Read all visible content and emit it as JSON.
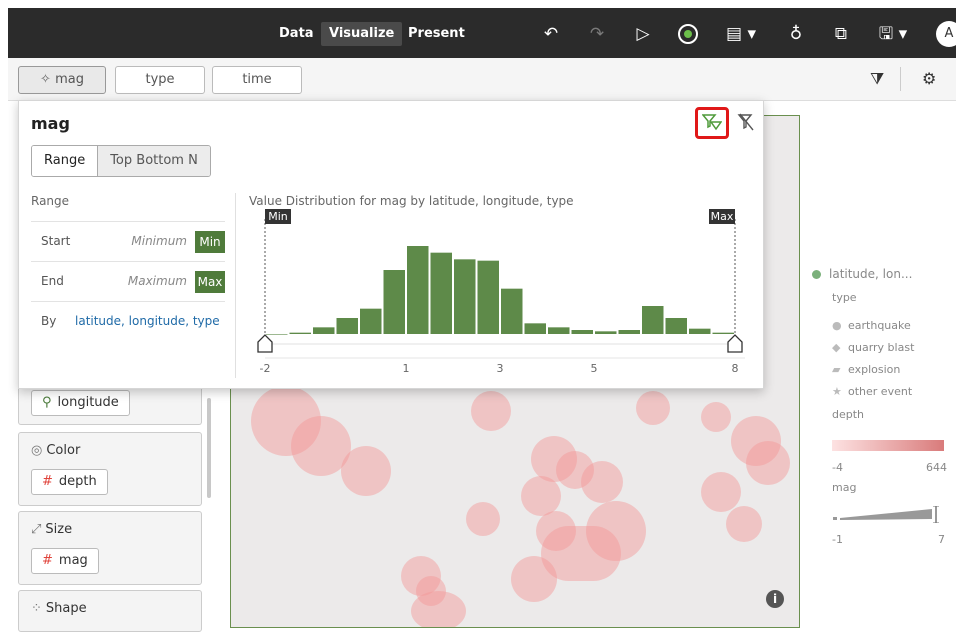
{
  "topbar": {
    "tabs": [
      "Data",
      "Visualize",
      "Present"
    ],
    "active_tab": "Visualize",
    "icons": [
      "undo-icon",
      "redo-icon",
      "play-icon",
      "record-icon",
      "comment-icon",
      "lightbulb-icon",
      "export-icon",
      "save-icon"
    ],
    "avatar": "A"
  },
  "filter_bar": {
    "filters": [
      "mag",
      "type",
      "time"
    ]
  },
  "grammar": {
    "longitude_chip": "longitude",
    "color": {
      "label": "Color",
      "chip": "depth"
    },
    "size": {
      "label": "Size",
      "chip": "mag"
    },
    "shape": {
      "label": "Shape"
    }
  },
  "popup": {
    "title": "mag",
    "tabs": [
      "Range",
      "Top Bottom N"
    ],
    "section_label": "Range",
    "rows": [
      {
        "label": "Start",
        "value": "Minimum",
        "badge": "Min"
      },
      {
        "label": "End",
        "value": "Maximum",
        "badge": "Max"
      }
    ],
    "by_label": "By",
    "by_value": "latitude, longitude, type",
    "chart_title": "Value Distribution for mag by latitude, longitude, type",
    "min_marker": "Min",
    "max_marker": "Max"
  },
  "chart_data": {
    "type": "bar",
    "title": "Value Distribution for mag by latitude, longitude, type",
    "xlabel": "",
    "ylabel": "",
    "x_ticks": [
      "-2",
      "1",
      "3",
      "5",
      "8"
    ],
    "bin_centers": [
      -1.75,
      -1.25,
      -0.75,
      -0.25,
      0.25,
      0.75,
      1.25,
      1.75,
      2.25,
      2.75,
      3.25,
      3.75,
      4.25,
      4.75,
      5.25,
      5.75,
      6.25,
      6.75,
      7.25,
      7.75
    ],
    "values": [
      0,
      1,
      5,
      12,
      19,
      48,
      66,
      61,
      56,
      55,
      34,
      8,
      5,
      3,
      2,
      3,
      21,
      12,
      4,
      1
    ],
    "range_min_label": "Min",
    "range_max_label": "Max",
    "grid": false
  },
  "legend": {
    "title": "latitude, lon...",
    "type_label": "type",
    "types": [
      {
        "name": "earthquake",
        "mark": "●"
      },
      {
        "name": "quarry blast",
        "mark": "◆"
      },
      {
        "name": "explosion",
        "mark": "▰"
      },
      {
        "name": "other event",
        "mark": "★"
      }
    ],
    "depth_label": "depth",
    "depth_min": "-4",
    "depth_max": "644",
    "mag_label": "mag",
    "mag_min": "-1",
    "mag_max": "7",
    "colors": {
      "accent": "#4f7b3b",
      "bar": "#5e8a49",
      "highlight": "#e01818"
    }
  },
  "map": {
    "info_label": "i"
  }
}
